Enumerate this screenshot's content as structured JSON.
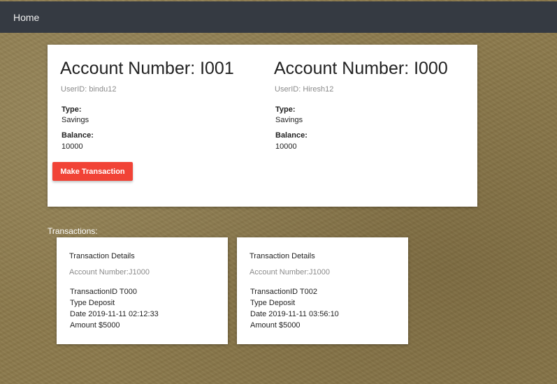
{
  "navbar": {
    "home_label": "Home"
  },
  "accounts": [
    {
      "title": "Account Number: I001",
      "user_id": "UserID: bindu12",
      "type_label": "Type:",
      "type_value": "Savings",
      "balance_label": "Balance:",
      "balance_value": "10000"
    },
    {
      "title": "Account Number: I000",
      "user_id": "UserID: Hiresh12",
      "type_label": "Type:",
      "type_value": "Savings",
      "balance_label": "Balance:",
      "balance_value": "10000"
    }
  ],
  "make_transaction_label": "Make Transaction",
  "transactions_heading": "Transactions:",
  "transactions": [
    {
      "title": "Transaction Details",
      "account": "Account Number:J1000",
      "transaction_id": "TransactionID T000",
      "type": "Type Deposit",
      "date": "Date 2019-11-11 02:12:33",
      "amount": "Amount $5000"
    },
    {
      "title": "Transaction Details",
      "account": "Account Number:J1000",
      "transaction_id": "TransactionID T002",
      "type": "Type Deposit",
      "date": "Date 2019-11-11 03:56:10",
      "amount": "Amount $5000"
    }
  ],
  "colors": {
    "navbar": "#353a42",
    "button": "#f14336",
    "background": "#8c7a4c"
  }
}
